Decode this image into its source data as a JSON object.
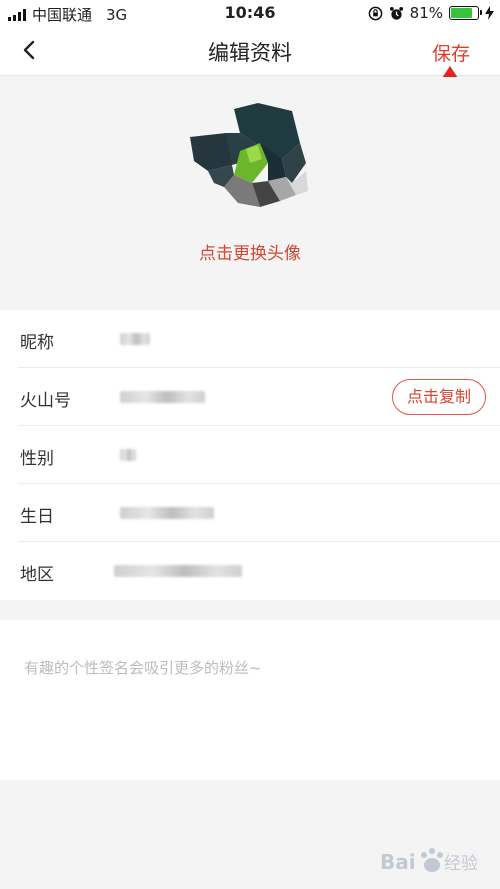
{
  "status_bar": {
    "carrier": "中国联通",
    "network": "3G",
    "time": "10:46",
    "battery": "81%",
    "battery_level": 0.81
  },
  "nav": {
    "title": "编辑资料",
    "save_label": "保存"
  },
  "avatar": {
    "change_label": "点击更换头像"
  },
  "fields": [
    {
      "label": "昵称"
    },
    {
      "label": "火山号",
      "action_label": "点击复制"
    },
    {
      "label": "性别"
    },
    {
      "label": "生日"
    },
    {
      "label": "地区"
    }
  ],
  "signature": {
    "placeholder": "有趣的个性签名会吸引更多的粉丝~"
  },
  "colors": {
    "accent": "#e03c2c",
    "arrow": "#e8231c",
    "background": "#f4f4f4"
  }
}
